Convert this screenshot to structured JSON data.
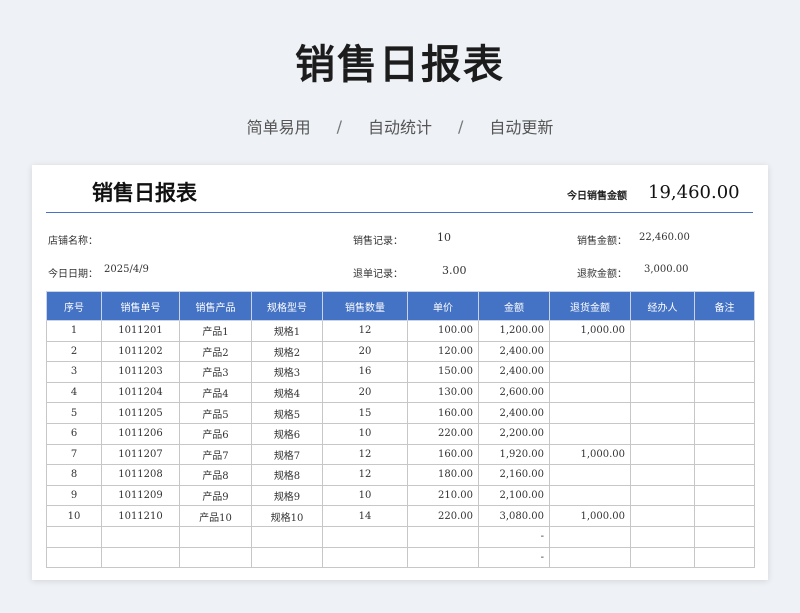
{
  "page": {
    "title": "销售日报表",
    "tagline": [
      "简单易用",
      "自动统计",
      "自动更新"
    ],
    "separator": "/"
  },
  "sheet": {
    "title": "销售日报表",
    "today_sales_label": "今日销售金额",
    "today_sales_value": "19,460.00",
    "info": {
      "store_label": "店铺名称：",
      "store_value": "",
      "date_label": "今日日期：",
      "date_value": "2025/4/9",
      "sales_records_label": "销售记录：",
      "sales_records_value": "10",
      "returns_label": "退单记录：",
      "returns_value": "3.00",
      "sales_amount_label": "销售金额：",
      "sales_amount_value": "22,460.00",
      "refund_label": "退款金额：",
      "refund_value": "3,000.00"
    },
    "columns": [
      "序号",
      "销售单号",
      "销售产品",
      "规格型号",
      "销售数量",
      "单价",
      "金额",
      "退货金额",
      "经办人",
      "备注"
    ],
    "rows": [
      [
        "1",
        "1011201",
        "产品1",
        "规格1",
        "12",
        "100.00",
        "1,200.00",
        "1,000.00",
        "",
        ""
      ],
      [
        "2",
        "1011202",
        "产品2",
        "规格2",
        "20",
        "120.00",
        "2,400.00",
        "",
        "",
        ""
      ],
      [
        "3",
        "1011203",
        "产品3",
        "规格3",
        "16",
        "150.00",
        "2,400.00",
        "",
        "",
        ""
      ],
      [
        "4",
        "1011204",
        "产品4",
        "规格4",
        "20",
        "130.00",
        "2,600.00",
        "",
        "",
        ""
      ],
      [
        "5",
        "1011205",
        "产品5",
        "规格5",
        "15",
        "160.00",
        "2,400.00",
        "",
        "",
        ""
      ],
      [
        "6",
        "1011206",
        "产品6",
        "规格6",
        "10",
        "220.00",
        "2,200.00",
        "",
        "",
        ""
      ],
      [
        "7",
        "1011207",
        "产品7",
        "规格7",
        "12",
        "160.00",
        "1,920.00",
        "1,000.00",
        "",
        ""
      ],
      [
        "8",
        "1011208",
        "产品8",
        "规格8",
        "12",
        "180.00",
        "2,160.00",
        "",
        "",
        ""
      ],
      [
        "9",
        "1011209",
        "产品9",
        "规格9",
        "10",
        "210.00",
        "2,100.00",
        "",
        "",
        ""
      ],
      [
        "10",
        "1011210",
        "产品10",
        "规格10",
        "14",
        "220.00",
        "3,080.00",
        "1,000.00",
        "",
        ""
      ],
      [
        "",
        "",
        "",
        "",
        "",
        "",
        "-",
        "",
        "",
        ""
      ],
      [
        "",
        "",
        "",
        "",
        "",
        "",
        "-",
        "",
        "",
        ""
      ]
    ]
  }
}
